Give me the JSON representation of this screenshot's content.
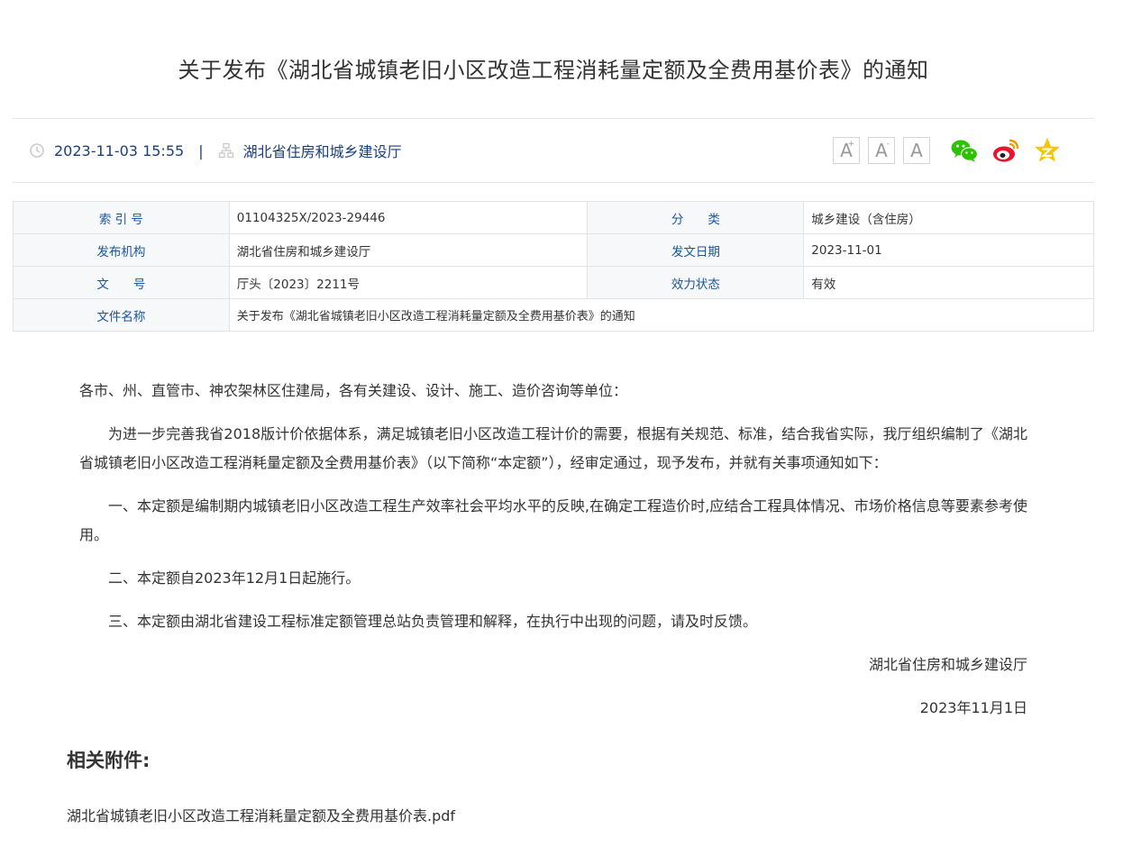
{
  "article": {
    "title": "关于发布《湖北省城镇老旧小区改造工程消耗量定额及全费用基价表》的通知",
    "datetime": "2023-11-03 15:55",
    "separator": "|",
    "publisher": "湖北省住房和城乡建设厅"
  },
  "toolbar": {
    "font_large": "A",
    "font_large_mark": "+",
    "font_small": "A",
    "font_small_mark": "-",
    "font_default": "A",
    "share_icons": [
      "wechat-icon",
      "weibo-icon",
      "qzone-icon"
    ],
    "colors": {
      "wechat": "#2dc100",
      "weibo": "#e6162d",
      "qzone": "#f8c600"
    }
  },
  "info_table": {
    "index_label": "索 引 号",
    "index_value": "01104325X/2023-29446",
    "category_label": "分　　类",
    "category_value": "城乡建设（含住房）",
    "org_label": "发布机构",
    "org_value": "湖北省住房和城乡建设厅",
    "date_label": "发文日期",
    "date_value": "2023-11-01",
    "docno_label": "文　　号",
    "docno_value": "厅头〔2023〕2211号",
    "status_label": "效力状态",
    "status_value": "有效",
    "name_label": "文件名称",
    "name_value": "关于发布《湖北省城镇老旧小区改造工程消耗量定额及全费用基价表》的通知"
  },
  "content": {
    "salutation": "各市、州、直管市、神农架林区住建局，各有关建设、设计、施工、造价咨询等单位：",
    "para1": "为进一步完善我省2018版计价依据体系，满足城镇老旧小区改造工程计价的需要，根据有关规范、标准，结合我省实际，我厅组织编制了《湖北省城镇老旧小区改造工程消耗量定额及全费用基价表》（以下简称“本定额”），经审定通过，现予发布，并就有关事项通知如下：",
    "item1": "一、本定额是编制期内城镇老旧小区改造工程生产效率社会平均水平的反映,在确定工程造价时,应结合工程具体情况、市场价格信息等要素参考使用。",
    "item2": "二、本定额自2023年12月1日起施行。",
    "item3": "三、本定额由湖北省建设工程标准定额管理总站负责管理和解释，在执行中出现的问题，请及时反馈。",
    "signature": "湖北省住房和城乡建设厅",
    "sign_date": "2023年11月1日"
  },
  "attachments": {
    "heading": "相关附件:",
    "file": "湖北省城镇老旧小区改造工程消耗量定额及全费用基价表.pdf"
  }
}
